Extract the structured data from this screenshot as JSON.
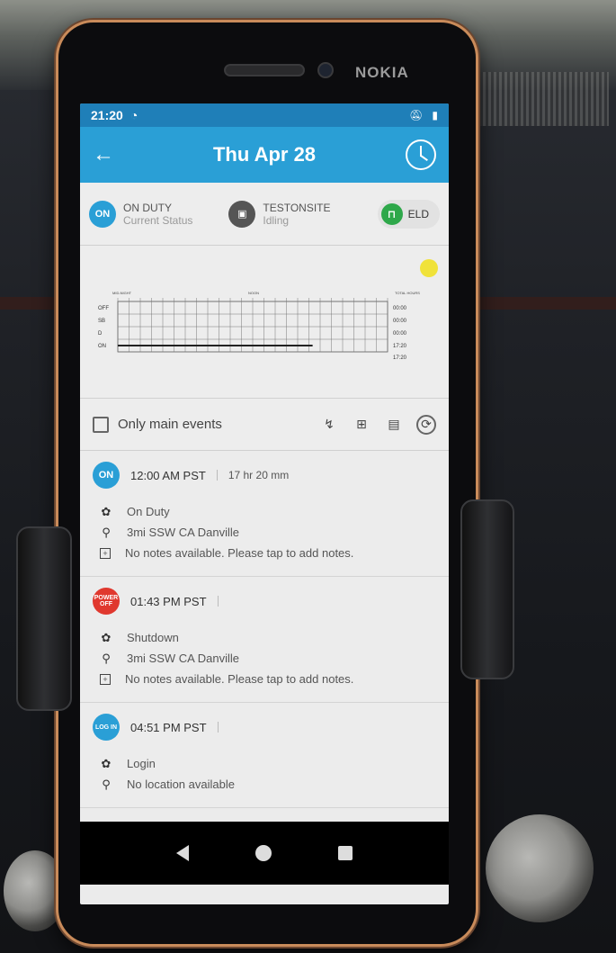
{
  "status_bar": {
    "time": "21:20"
  },
  "header": {
    "title": "Thu Apr 28"
  },
  "device": {
    "brand": "NOKIA"
  },
  "status_row": {
    "duty": {
      "badge": "ON",
      "title": "ON DUTY",
      "subtitle": "Current Status"
    },
    "vehicle": {
      "title": "TESTONSITE",
      "subtitle": "Idling"
    },
    "eld": {
      "label": "ELD"
    }
  },
  "chart_data": {
    "type": "table",
    "rows": [
      "OFF",
      "SB",
      "D",
      "ON"
    ],
    "top_labels": [
      "MID-NIGHT",
      "NOON",
      "TOTAL HOURS"
    ],
    "totals": [
      "00:00",
      "00:00",
      "00:00",
      "17:20"
    ],
    "grand_total": "17:20",
    "segments": [
      {
        "row": "ON",
        "start_hour": 0,
        "end_hour": 17.33
      }
    ]
  },
  "filter": {
    "label": "Only main events"
  },
  "events": [
    {
      "badge": "ON",
      "time": "12:00 AM PST",
      "duration": "17 hr 20 mm",
      "type": "On Duty",
      "location": "3mi SSW CA Danville",
      "notes": "No notes available. Please tap to add notes."
    },
    {
      "badge": "POWER OFF",
      "time": "01:43 PM PST",
      "duration": "",
      "type": "Shutdown",
      "location": "3mi SSW CA Danville",
      "notes": "No notes available. Please tap to add notes."
    },
    {
      "badge": "LOG IN",
      "time": "04:51 PM PST",
      "duration": "",
      "type": "Login",
      "location": "No location available",
      "notes": ""
    }
  ],
  "colors": {
    "app_bar": "#2a9fd6",
    "status_bar": "#1f7fb8",
    "on_duty": "#2a9fd6",
    "power_off": "#e0382e",
    "eld": "#2ea84a"
  }
}
